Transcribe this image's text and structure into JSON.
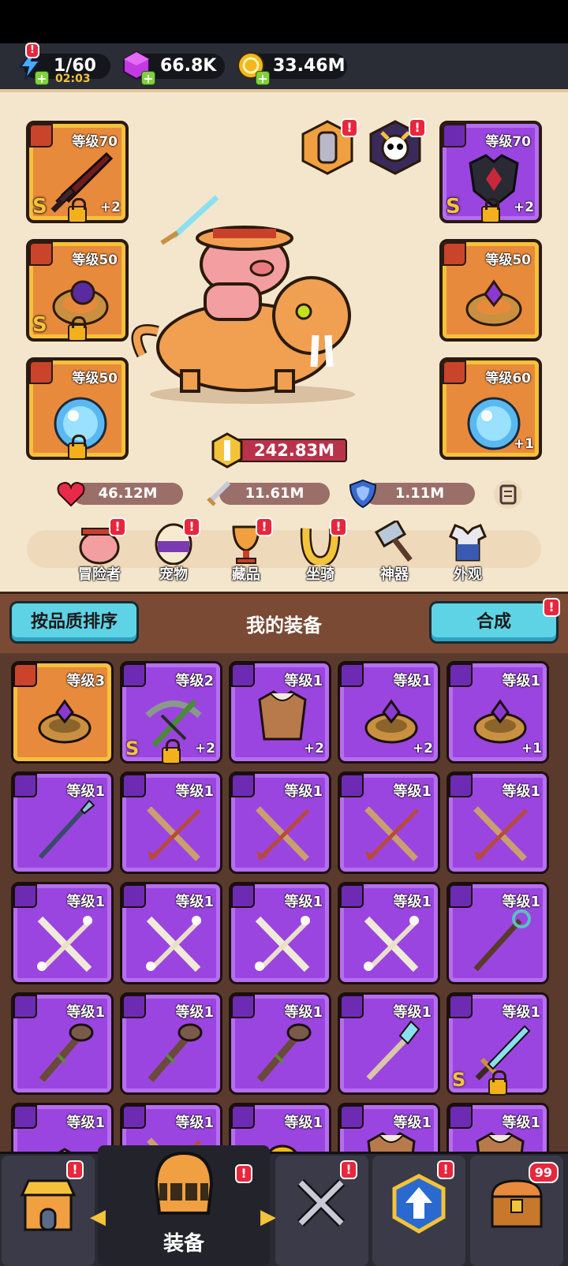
{
  "resources": {
    "energy": "1/60",
    "energy_timer": "02:03",
    "gems": "66.8K",
    "gold": "33.46M",
    "plus": "+"
  },
  "equipment_left": [
    {
      "level": "等级70",
      "plus": "+2",
      "grade": "S",
      "locked": true
    },
    {
      "level": "等级50",
      "plus": "",
      "grade": "S",
      "locked": true
    },
    {
      "level": "等级50",
      "plus": "",
      "grade": "",
      "locked": true
    }
  ],
  "equipment_right": [
    {
      "level": "等级70",
      "plus": "+2",
      "grade": "S",
      "locked": true
    },
    {
      "level": "等级50",
      "plus": "",
      "grade": "",
      "locked": false
    },
    {
      "level": "等级60",
      "plus": "+1",
      "grade": "",
      "locked": false
    }
  ],
  "power": "242.83M",
  "stats": {
    "hp": "46.12M",
    "attack": "11.61M",
    "defense": "1.11M"
  },
  "nav": [
    {
      "label": "冒险者"
    },
    {
      "label": "宠物"
    },
    {
      "label": "藏品"
    },
    {
      "label": "坐骑"
    },
    {
      "label": "神器"
    },
    {
      "label": "外观"
    }
  ],
  "badge": "!",
  "sort_button": "按品质排序",
  "section_title": "我的装备",
  "merge_button": "合成",
  "inventory": [
    {
      "level": "等级3",
      "plus": "",
      "grade": "",
      "kind": "ring",
      "rarity": "gold"
    },
    {
      "level": "等级2",
      "plus": "+2",
      "grade": "S",
      "kind": "crossbow",
      "rarity": "purple"
    },
    {
      "level": "等级1",
      "plus": "+2",
      "grade": "",
      "kind": "armor",
      "rarity": "purple"
    },
    {
      "level": "等级1",
      "plus": "+2",
      "grade": "",
      "kind": "ring",
      "rarity": "purple"
    },
    {
      "level": "等级1",
      "plus": "+1",
      "grade": "",
      "kind": "ring",
      "rarity": "purple"
    },
    {
      "level": "等级1",
      "plus": "",
      "grade": "",
      "kind": "spear",
      "rarity": "purple"
    },
    {
      "level": "等级1",
      "plus": "",
      "grade": "",
      "kind": "bow",
      "rarity": "purple"
    },
    {
      "level": "等级1",
      "plus": "",
      "grade": "",
      "kind": "bow",
      "rarity": "purple"
    },
    {
      "level": "等级1",
      "plus": "",
      "grade": "",
      "kind": "bow",
      "rarity": "purple"
    },
    {
      "level": "等级1",
      "plus": "",
      "grade": "",
      "kind": "bow",
      "rarity": "purple"
    },
    {
      "level": "等级1",
      "plus": "",
      "grade": "",
      "kind": "bonebow",
      "rarity": "purple"
    },
    {
      "level": "等级1",
      "plus": "",
      "grade": "",
      "kind": "bonebow",
      "rarity": "purple"
    },
    {
      "level": "等级1",
      "plus": "",
      "grade": "",
      "kind": "bonebow",
      "rarity": "purple"
    },
    {
      "level": "等级1",
      "plus": "",
      "grade": "",
      "kind": "bonebow",
      "rarity": "purple"
    },
    {
      "level": "等级1",
      "plus": "",
      "grade": "",
      "kind": "staff",
      "rarity": "purple"
    },
    {
      "level": "等级1",
      "plus": "",
      "grade": "",
      "kind": "club",
      "rarity": "purple"
    },
    {
      "level": "等级1",
      "plus": "",
      "grade": "",
      "kind": "club",
      "rarity": "purple"
    },
    {
      "level": "等级1",
      "plus": "",
      "grade": "",
      "kind": "club",
      "rarity": "purple"
    },
    {
      "level": "等级1",
      "plus": "",
      "grade": "",
      "kind": "wand",
      "rarity": "purple"
    },
    {
      "level": "等级1",
      "plus": "",
      "grade": "S",
      "kind": "sword",
      "rarity": "purple"
    },
    {
      "level": "等级1",
      "plus": "",
      "grade": "",
      "kind": "gem",
      "rarity": "purple"
    },
    {
      "level": "等级1",
      "plus": "",
      "grade": "",
      "kind": "bow",
      "rarity": "purple"
    },
    {
      "level": "等级1",
      "plus": "",
      "grade": "",
      "kind": "helmet",
      "rarity": "purple"
    },
    {
      "level": "等级1",
      "plus": "",
      "grade": "",
      "kind": "armor",
      "rarity": "purple"
    },
    {
      "level": "等级1",
      "plus": "",
      "grade": "",
      "kind": "armor",
      "rarity": "purple"
    }
  ],
  "bottom_tabs": [
    {
      "label": ""
    },
    {
      "label": "装备"
    },
    {
      "label": ""
    },
    {
      "label": ""
    },
    {
      "label": ""
    }
  ],
  "chest_count": "99",
  "colors": {
    "gold": "#f6c13a",
    "purple": "#9b45e0",
    "accent": "#5fd3e6"
  }
}
